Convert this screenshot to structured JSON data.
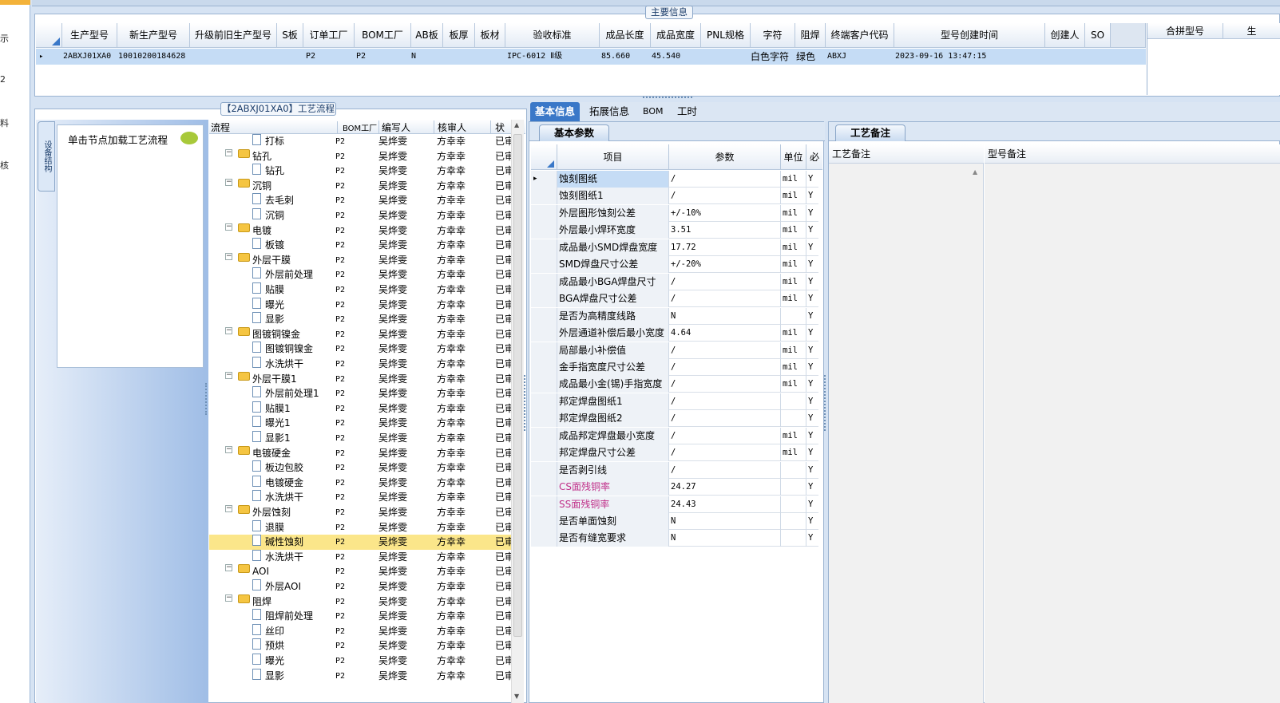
{
  "nav": {
    "items": [
      "示",
      "2",
      "料",
      "核"
    ]
  },
  "main_info": {
    "title": "主要信息",
    "columns": [
      "生产型号",
      "新生产型号",
      "升级前旧生产型号",
      "S板",
      "订单工厂",
      "BOM工厂",
      "AB板",
      "板厚",
      "板材",
      "验收标准",
      "成品长度",
      "成品宽度",
      "PNL规格",
      "字符",
      "阻焊",
      "终端客户代码",
      "型号创建时间",
      "创建人",
      "SO"
    ],
    "row": {
      "prod_model": "2ABXJ01XA0",
      "new_model": "10010200184628",
      "order_factory": "P2",
      "bom_factory": "P2",
      "ab": "N",
      "standard": "IPC-6012 Ⅱ级",
      "length": "85.660",
      "width": "45.540",
      "char": "白色字符",
      "solder": "绿色",
      "customer": "ABXJ",
      "created": "2023-09-16 13:47:15"
    },
    "merge_columns": [
      "合拼型号",
      "生"
    ]
  },
  "process": {
    "title": "【2ABXJ01XA0】工艺流程",
    "side_tab": "设备结构",
    "hint": "单击节点加载工艺流程",
    "columns": [
      "流程",
      "BOM工厂",
      "编写人",
      "核审人",
      "状"
    ],
    "rows": [
      {
        "level": 2,
        "type": "doc",
        "name": "打标",
        "f": "P2",
        "w": "吴烨雯",
        "r": "方幸幸",
        "s": "已审"
      },
      {
        "level": 1,
        "type": "folder",
        "name": "钻孔",
        "f": "P2",
        "w": "吴烨雯",
        "r": "方幸幸",
        "s": "已审"
      },
      {
        "level": 2,
        "type": "doc",
        "name": "钻孔",
        "f": "P2",
        "w": "吴烨雯",
        "r": "方幸幸",
        "s": "已审"
      },
      {
        "level": 1,
        "type": "folder",
        "name": "沉铜",
        "f": "P2",
        "w": "吴烨雯",
        "r": "方幸幸",
        "s": "已审"
      },
      {
        "level": 2,
        "type": "doc",
        "name": "去毛刺",
        "f": "P2",
        "w": "吴烨雯",
        "r": "方幸幸",
        "s": "已审"
      },
      {
        "level": 2,
        "type": "doc",
        "name": "沉铜",
        "f": "P2",
        "w": "吴烨雯",
        "r": "方幸幸",
        "s": "已审"
      },
      {
        "level": 1,
        "type": "folder",
        "name": "电镀",
        "f": "P2",
        "w": "吴烨雯",
        "r": "方幸幸",
        "s": "已审"
      },
      {
        "level": 2,
        "type": "doc",
        "name": "板镀",
        "f": "P2",
        "w": "吴烨雯",
        "r": "方幸幸",
        "s": "已审"
      },
      {
        "level": 1,
        "type": "folder",
        "name": "外层干膜",
        "f": "P2",
        "w": "吴烨雯",
        "r": "方幸幸",
        "s": "已审"
      },
      {
        "level": 2,
        "type": "doc",
        "name": "外层前处理",
        "f": "P2",
        "w": "吴烨雯",
        "r": "方幸幸",
        "s": "已审"
      },
      {
        "level": 2,
        "type": "doc",
        "name": "贴膜",
        "f": "P2",
        "w": "吴烨雯",
        "r": "方幸幸",
        "s": "已审"
      },
      {
        "level": 2,
        "type": "doc",
        "name": "曝光",
        "f": "P2",
        "w": "吴烨雯",
        "r": "方幸幸",
        "s": "已审"
      },
      {
        "level": 2,
        "type": "doc",
        "name": "显影",
        "f": "P2",
        "w": "吴烨雯",
        "r": "方幸幸",
        "s": "已审"
      },
      {
        "level": 1,
        "type": "folder",
        "name": "图镀铜镍金",
        "f": "P2",
        "w": "吴烨雯",
        "r": "方幸幸",
        "s": "已审"
      },
      {
        "level": 2,
        "type": "doc",
        "name": "图镀铜镍金",
        "f": "P2",
        "w": "吴烨雯",
        "r": "方幸幸",
        "s": "已审"
      },
      {
        "level": 2,
        "type": "doc",
        "name": "水洗烘干",
        "f": "P2",
        "w": "吴烨雯",
        "r": "方幸幸",
        "s": "已审"
      },
      {
        "level": 1,
        "type": "folder",
        "name": "外层干膜1",
        "f": "P2",
        "w": "吴烨雯",
        "r": "方幸幸",
        "s": "已审"
      },
      {
        "level": 2,
        "type": "doc",
        "name": "外层前处理1",
        "f": "P2",
        "w": "吴烨雯",
        "r": "方幸幸",
        "s": "已审"
      },
      {
        "level": 2,
        "type": "doc",
        "name": "贴膜1",
        "f": "P2",
        "w": "吴烨雯",
        "r": "方幸幸",
        "s": "已审"
      },
      {
        "level": 2,
        "type": "doc",
        "name": "曝光1",
        "f": "P2",
        "w": "吴烨雯",
        "r": "方幸幸",
        "s": "已审"
      },
      {
        "level": 2,
        "type": "doc",
        "name": "显影1",
        "f": "P2",
        "w": "吴烨雯",
        "r": "方幸幸",
        "s": "已审"
      },
      {
        "level": 1,
        "type": "folder",
        "name": "电镀硬金",
        "f": "P2",
        "w": "吴烨雯",
        "r": "方幸幸",
        "s": "已审"
      },
      {
        "level": 2,
        "type": "doc",
        "name": "板边包胶",
        "f": "P2",
        "w": "吴烨雯",
        "r": "方幸幸",
        "s": "已审"
      },
      {
        "level": 2,
        "type": "doc",
        "name": "电镀硬金",
        "f": "P2",
        "w": "吴烨雯",
        "r": "方幸幸",
        "s": "已审"
      },
      {
        "level": 2,
        "type": "doc",
        "name": "水洗烘干",
        "f": "P2",
        "w": "吴烨雯",
        "r": "方幸幸",
        "s": "已审"
      },
      {
        "level": 1,
        "type": "folder",
        "name": "外层蚀刻",
        "f": "P2",
        "w": "吴烨雯",
        "r": "方幸幸",
        "s": "已审"
      },
      {
        "level": 2,
        "type": "doc",
        "name": "退膜",
        "f": "P2",
        "w": "吴烨雯",
        "r": "方幸幸",
        "s": "已审"
      },
      {
        "level": 2,
        "type": "doc",
        "name": "碱性蚀刻",
        "f": "P2",
        "w": "吴烨雯",
        "r": "方幸幸",
        "s": "已审",
        "selected": true
      },
      {
        "level": 2,
        "type": "doc",
        "name": "水洗烘干",
        "f": "P2",
        "w": "吴烨雯",
        "r": "方幸幸",
        "s": "已审"
      },
      {
        "level": 1,
        "type": "folder",
        "name": "AOI",
        "f": "P2",
        "w": "吴烨雯",
        "r": "方幸幸",
        "s": "已审"
      },
      {
        "level": 2,
        "type": "doc",
        "name": "外层AOI",
        "f": "P2",
        "w": "吴烨雯",
        "r": "方幸幸",
        "s": "已审"
      },
      {
        "level": 1,
        "type": "folder",
        "name": "阻焊",
        "f": "P2",
        "w": "吴烨雯",
        "r": "方幸幸",
        "s": "已审"
      },
      {
        "level": 2,
        "type": "doc",
        "name": "阻焊前处理",
        "f": "P2",
        "w": "吴烨雯",
        "r": "方幸幸",
        "s": "已审"
      },
      {
        "level": 2,
        "type": "doc",
        "name": "丝印",
        "f": "P2",
        "w": "吴烨雯",
        "r": "方幸幸",
        "s": "已审"
      },
      {
        "level": 2,
        "type": "doc",
        "name": "预烘",
        "f": "P2",
        "w": "吴烨雯",
        "r": "方幸幸",
        "s": "已审"
      },
      {
        "level": 2,
        "type": "doc",
        "name": "曝光",
        "f": "P2",
        "w": "吴烨雯",
        "r": "方幸幸",
        "s": "已审"
      },
      {
        "level": 2,
        "type": "doc",
        "name": "显影",
        "f": "P2",
        "w": "吴烨雯",
        "r": "方幸幸",
        "s": "已审"
      }
    ]
  },
  "detail": {
    "tabs": [
      "基本信息",
      "拓展信息",
      "BOM",
      "工时"
    ],
    "sub_tab": "基本参数",
    "param_columns": [
      "项目",
      "参数",
      "单位",
      "必"
    ],
    "params": [
      {
        "item": "蚀刻图纸",
        "value": "/",
        "unit": "mil",
        "req": "Y",
        "sel": true
      },
      {
        "item": "蚀刻图纸1",
        "value": "/",
        "unit": "mil",
        "req": "Y"
      },
      {
        "item": "外层图形蚀刻公差",
        "value": "+/-10%",
        "unit": "mil",
        "req": "Y"
      },
      {
        "item": "外层最小焊环宽度",
        "value": "3.51",
        "unit": "mil",
        "req": "Y"
      },
      {
        "item": "成品最小SMD焊盘宽度",
        "value": "17.72",
        "unit": "mil",
        "req": "Y"
      },
      {
        "item": "SMD焊盘尺寸公差",
        "value": "+/-20%",
        "unit": "mil",
        "req": "Y"
      },
      {
        "item": "成品最小BGA焊盘尺寸",
        "value": "/",
        "unit": "mil",
        "req": "Y"
      },
      {
        "item": "BGA焊盘尺寸公差",
        "value": "/",
        "unit": "mil",
        "req": "Y"
      },
      {
        "item": "是否为高精度线路",
        "value": "N",
        "unit": "",
        "req": "Y"
      },
      {
        "item": "外层通道补偿后最小宽度",
        "value": "4.64",
        "unit": "mil",
        "req": "Y"
      },
      {
        "item": "局部最小补偿值",
        "value": "/",
        "unit": "mil",
        "req": "Y"
      },
      {
        "item": "金手指宽度尺寸公差",
        "value": "/",
        "unit": "mil",
        "req": "Y"
      },
      {
        "item": "成品最小金(锡)手指宽度",
        "value": "/",
        "unit": "mil",
        "req": "Y"
      },
      {
        "item": "邦定焊盘图纸1",
        "value": "/",
        "unit": "",
        "req": "Y"
      },
      {
        "item": "邦定焊盘图纸2",
        "value": "/",
        "unit": "",
        "req": "Y"
      },
      {
        "item": "成品邦定焊盘最小宽度",
        "value": "/",
        "unit": "mil",
        "req": "Y"
      },
      {
        "item": "邦定焊盘尺寸公差",
        "value": "/",
        "unit": "mil",
        "req": "Y"
      },
      {
        "item": "是否剥引线",
        "value": "/",
        "unit": "",
        "req": "Y"
      },
      {
        "item": "CS面残铜率",
        "value": "24.27",
        "unit": "",
        "req": "Y",
        "pink": true
      },
      {
        "item": "SS面残铜率",
        "value": "24.43",
        "unit": "",
        "req": "Y",
        "pink": true
      },
      {
        "item": "是否单面蚀刻",
        "value": "N",
        "unit": "",
        "req": "Y"
      },
      {
        "item": "是否有缝宽要求",
        "value": "N",
        "unit": "",
        "req": "Y"
      }
    ]
  },
  "notes": {
    "tab": "工艺备注",
    "col1": "工艺备注",
    "col2": "型号备注"
  },
  "colors": {
    "accent": "#3a78c8",
    "selected_row": "#fbe68a",
    "pink": "#c0308a"
  }
}
